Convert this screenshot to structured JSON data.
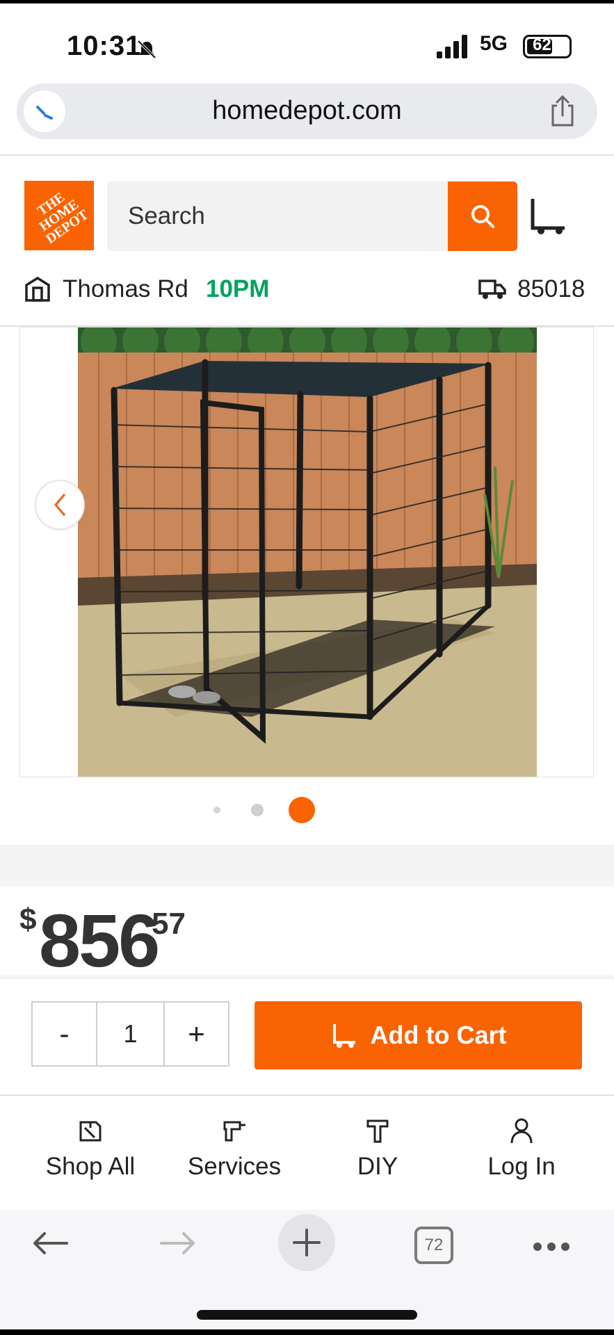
{
  "status_bar": {
    "time": "10:31",
    "network": "5G",
    "battery": "62"
  },
  "browser": {
    "url": "homedepot.com",
    "tab_count": "72"
  },
  "header": {
    "logo_text": "THE HOME DEPOT",
    "search_placeholder": "Search"
  },
  "store": {
    "name": "Thomas Rd",
    "hours": "10PM",
    "zip": "85018"
  },
  "gallery": {
    "image_count": 3,
    "active_index": 2
  },
  "product": {
    "price_currency": "$",
    "price_whole": "856",
    "price_cents": "57"
  },
  "purchase": {
    "qty_minus": "-",
    "qty_value": "1",
    "qty_plus": "+",
    "add_to_cart": "Add to Cart"
  },
  "bottom_nav": [
    {
      "label": "Shop All",
      "icon": "tag-icon"
    },
    {
      "label": "Services",
      "icon": "drill-icon"
    },
    {
      "label": "DIY",
      "icon": "hammer-icon"
    },
    {
      "label": "Log In",
      "icon": "user-icon"
    }
  ],
  "colors": {
    "brand_orange": "#f96302",
    "hours_green": "#00a35c"
  }
}
